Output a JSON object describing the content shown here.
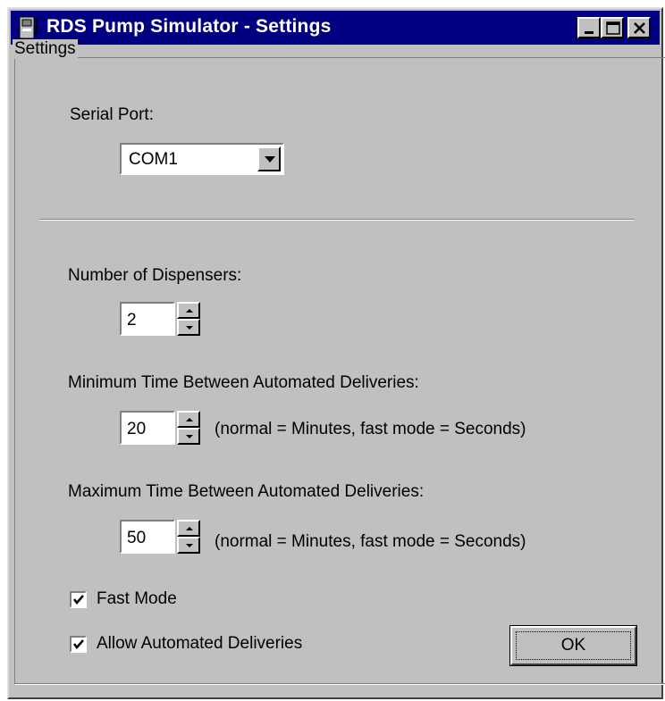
{
  "window": {
    "title": "RDS Pump Simulator - Settings",
    "icon": "pump-icon",
    "controls": {
      "minimize": "minimize-icon",
      "maximize": "maximize-icon",
      "close": "close-icon"
    }
  },
  "settings": {
    "group_label": "Settings",
    "serial_port": {
      "label": "Serial Port:",
      "value": "COM1"
    },
    "dispensers": {
      "label": "Number of Dispensers:",
      "value": "2"
    },
    "min_time": {
      "label": "Minimum Time Between Automated Deliveries:",
      "value": "20",
      "hint": "(normal = Minutes, fast mode = Seconds)"
    },
    "max_time": {
      "label": "Maximum Time Between Automated Deliveries:",
      "value": "50",
      "hint": "(normal = Minutes, fast mode = Seconds)"
    },
    "fast_mode": {
      "label": "Fast Mode",
      "checked": true
    },
    "allow_auto": {
      "label": "Allow Automated Deliveries",
      "checked": true
    },
    "ok_label": "OK"
  },
  "colors": {
    "titlebar": "#000080",
    "face": "#c0c0c0"
  }
}
